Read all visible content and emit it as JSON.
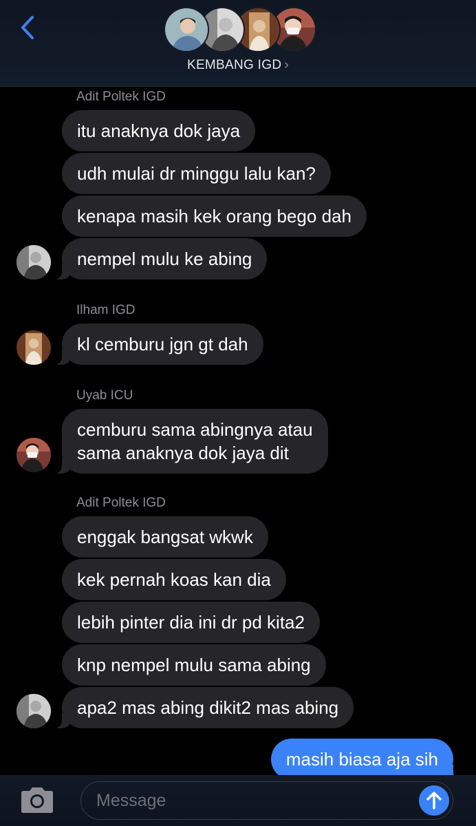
{
  "header": {
    "group_name": "KEMBANG IGD",
    "chevron": "›",
    "back_icon": "chevron-left-icon",
    "accent": "#3a82f7"
  },
  "messages": {
    "g1": {
      "sender": "Adit Poltek IGD",
      "b1": "itu anaknya dok jaya",
      "b2": "udh mulai dr minggu lalu kan?",
      "b3": "kenapa masih kek orang bego dah",
      "b4": "nempel mulu ke abing"
    },
    "g2": {
      "sender": "Ilham IGD",
      "b1": "kl cemburu jgn gt dah"
    },
    "g3": {
      "sender": "Uyab ICU",
      "b1_line1": "cemburu sama abingnya atau",
      "b1_line2": "sama anaknya dok jaya dit"
    },
    "g4": {
      "sender": "Adit Poltek IGD",
      "b1": "enggak bangsat wkwk",
      "b2": "kek pernah koas kan dia",
      "b3": "lebih pinter dia ini dr pd kita2",
      "b4": "knp nempel mulu sama abing",
      "b5": "apa2 mas abing dikit2 mas abing"
    },
    "me": {
      "b1": "masih biasa aja sih"
    }
  },
  "composer": {
    "placeholder": "Message",
    "camera_icon": "camera-icon",
    "send_icon": "arrow-up-icon"
  }
}
